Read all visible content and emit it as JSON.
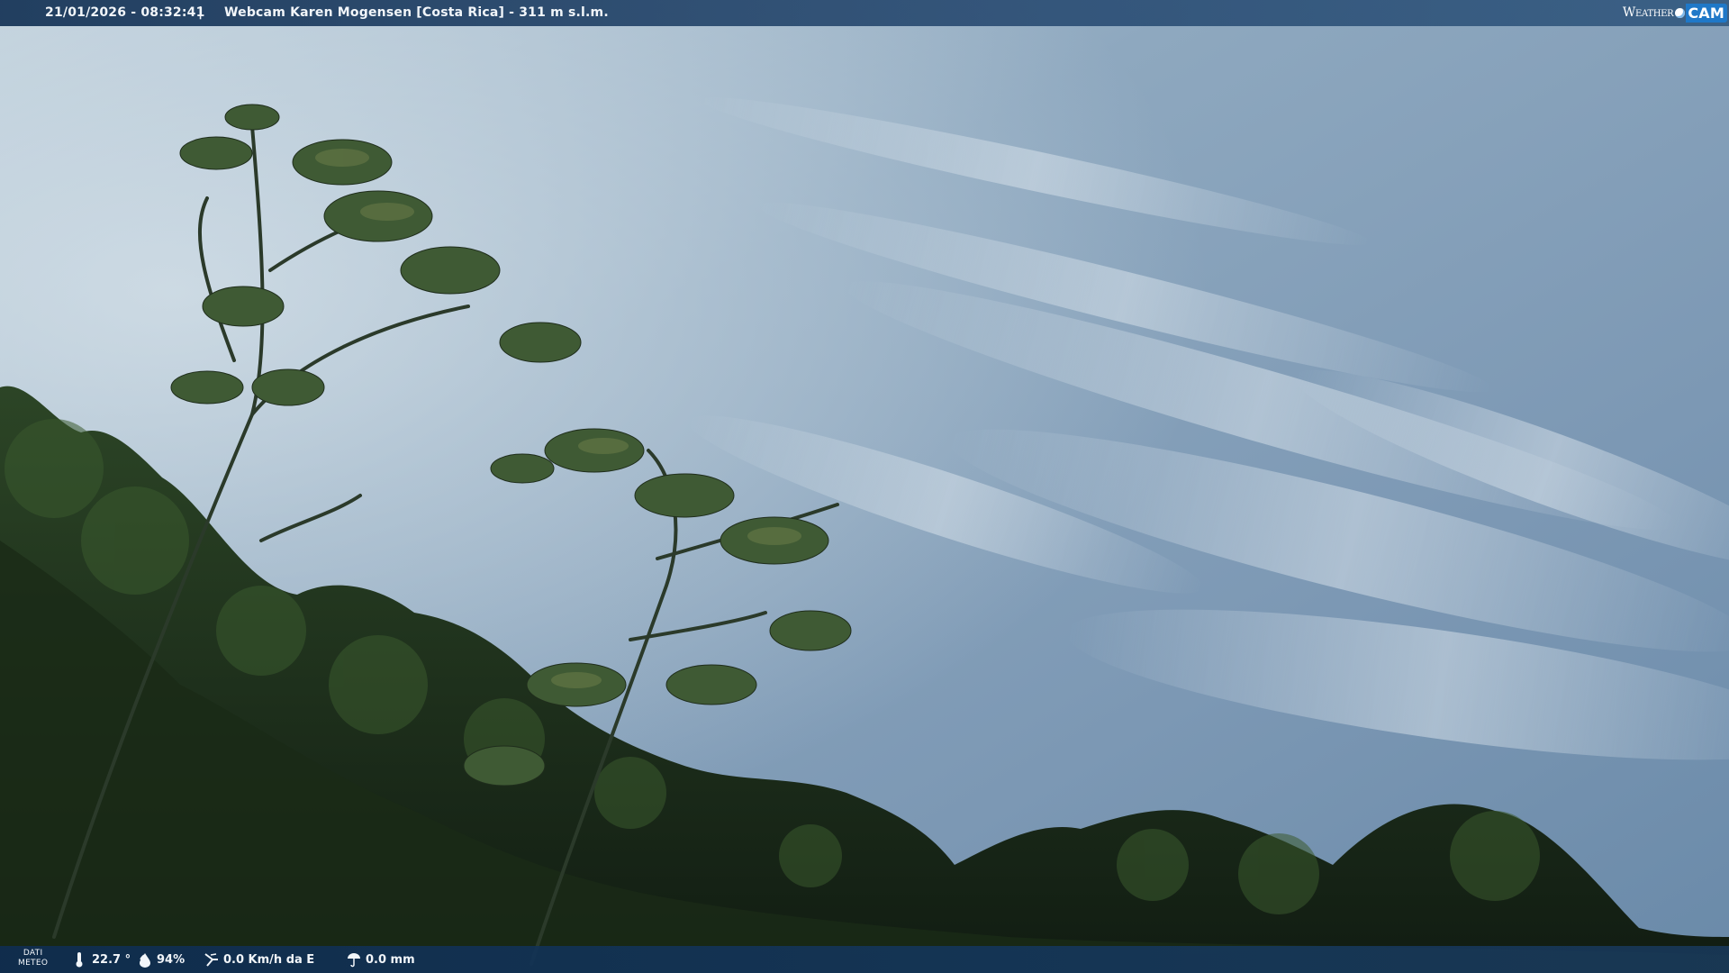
{
  "header": {
    "timestamp": "21/01/2026 - 08:32:41",
    "separator": "|",
    "title": "Webcam Karen Mogensen [Costa Rica] - 311 m s.l.m.",
    "brand_weather": "Weather",
    "brand_cam": "CAM"
  },
  "footer": {
    "dati_line1": "DATI",
    "dati_line2": "METEO",
    "temperature": "22.7 °",
    "humidity": "94%",
    "wind": "0.0 Km/h da E",
    "rain": "0.0 mm"
  },
  "icons": {
    "temperature": "thermometer-icon",
    "humidity": "drop-icon",
    "wind": "wind-icon",
    "rain": "rain-icon"
  },
  "colors": {
    "bar": "#143255",
    "brand_cam": "#1f78c8",
    "sky": "#8fa8bd",
    "foliage": "#1c2e1a"
  }
}
